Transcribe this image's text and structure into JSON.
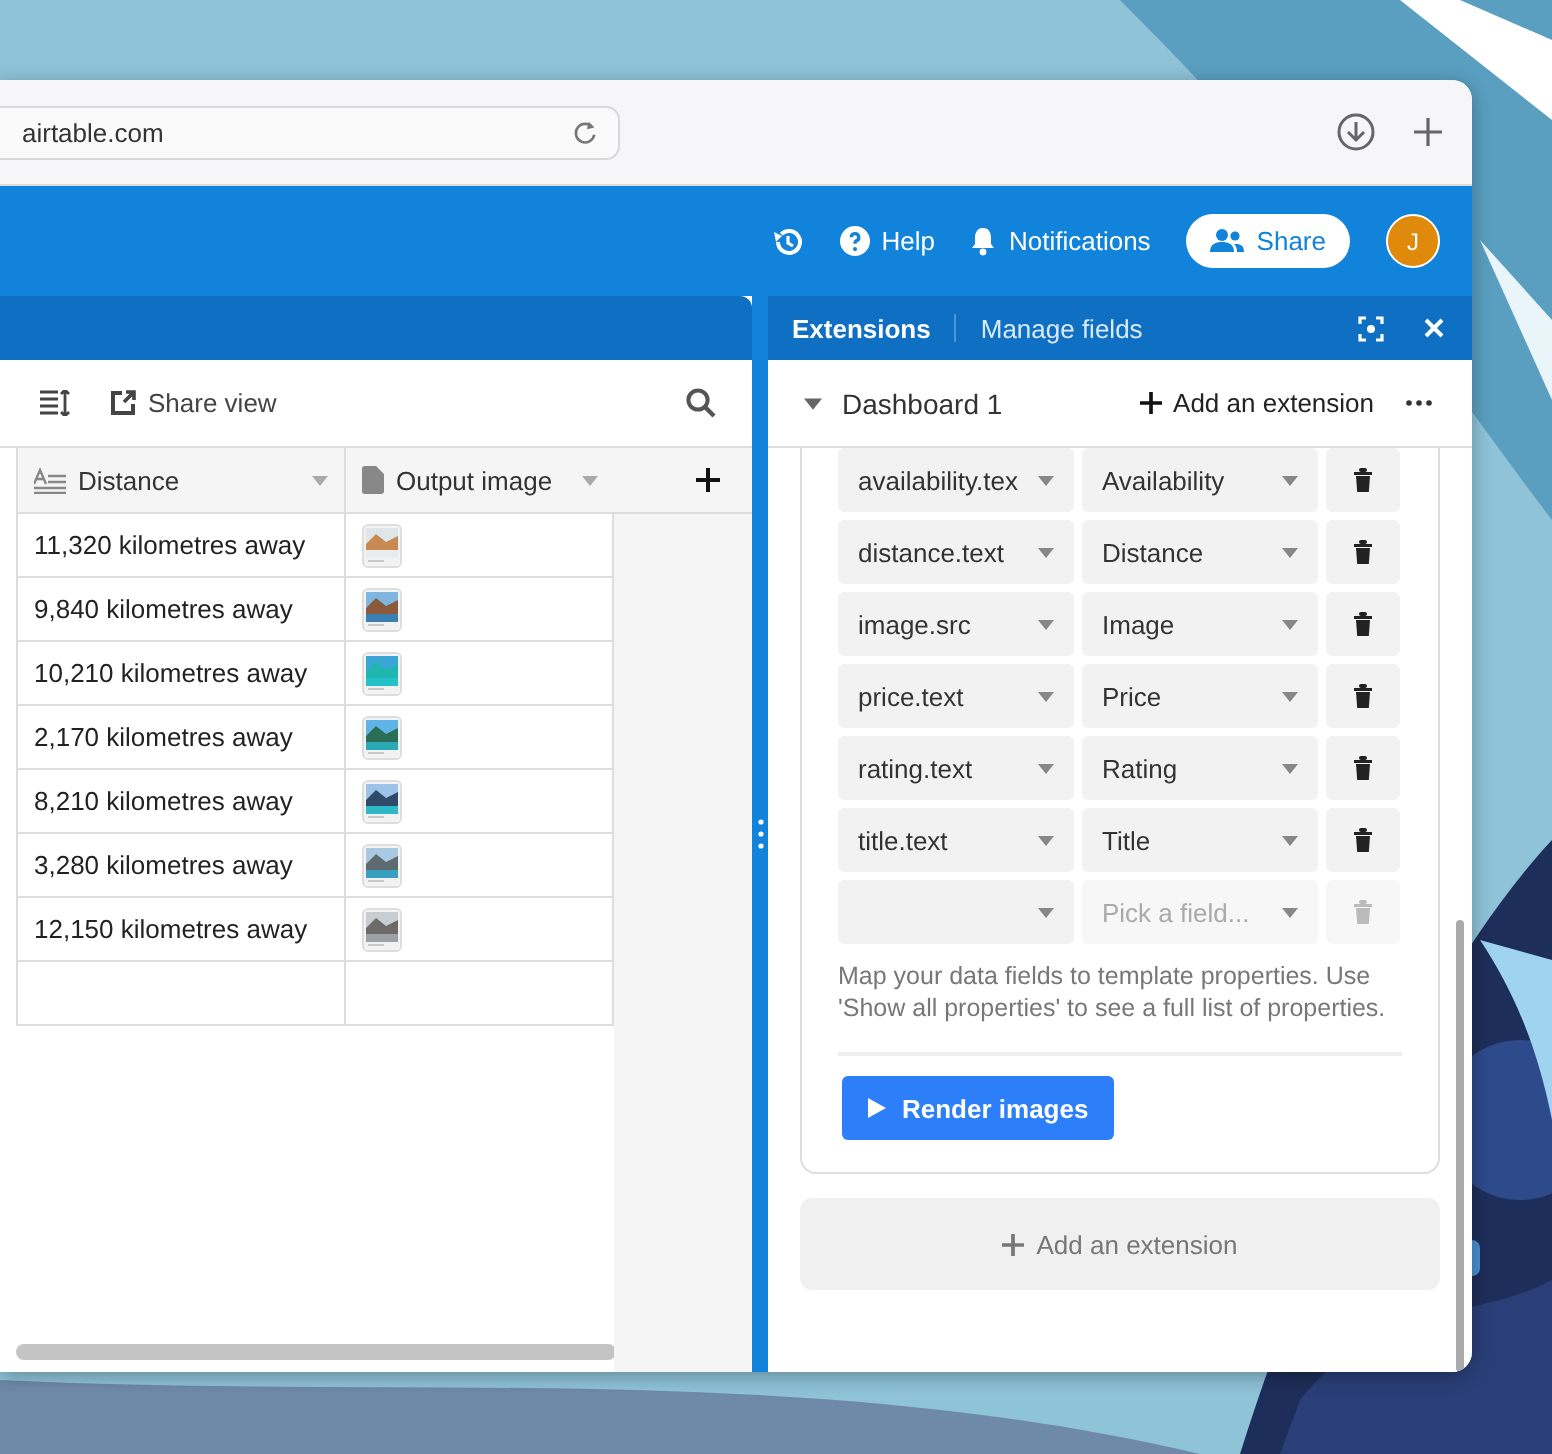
{
  "browser": {
    "address": "airtable.com"
  },
  "app_bar": {
    "help": "Help",
    "notifications": "Notifications",
    "share": "Share",
    "avatar": "J"
  },
  "view_toolbar": {
    "share_view": "Share view"
  },
  "table": {
    "columns": [
      {
        "name": "Distance",
        "kind": "text"
      },
      {
        "name": "Output image",
        "kind": "attachment"
      }
    ],
    "rows": [
      {
        "distance": "11,320 kilometres away"
      },
      {
        "distance": "9,840 kilometres away"
      },
      {
        "distance": "10,210 kilometres away"
      },
      {
        "distance": "2,170 kilometres away"
      },
      {
        "distance": "8,210 kilometres away"
      },
      {
        "distance": "3,280 kilometres away"
      },
      {
        "distance": "12,150 kilometres away"
      }
    ]
  },
  "panel": {
    "tabs": [
      {
        "label": "Extensions",
        "selected": true
      },
      {
        "label": "Manage fields",
        "selected": false
      }
    ],
    "dashboard": "Dashboard 1",
    "add_extension": "Add an extension",
    "mappings": [
      {
        "kind": "mapped",
        "property": "availability.tex",
        "field": "Availability",
        "disabled": false
      },
      {
        "kind": "mapped",
        "property": "distance.text",
        "field": "Distance",
        "disabled": false
      },
      {
        "kind": "mapped",
        "property": "image.src",
        "field": "Image",
        "disabled": false
      },
      {
        "kind": "mapped",
        "property": "price.text",
        "field": "Price",
        "disabled": false
      },
      {
        "kind": "mapped",
        "property": "rating.text",
        "field": "Rating",
        "disabled": false
      },
      {
        "kind": "mapped",
        "property": "title.text",
        "field": "Title",
        "disabled": false
      },
      {
        "kind": "empty",
        "field_placeholder": "Pick a field...",
        "disabled": true
      }
    ],
    "help_text": "Map your data fields to template properties. Use 'Show all properties' to see a full list of properties.",
    "render_button": "Render images",
    "add_extension_bottom": "Add an extension"
  }
}
